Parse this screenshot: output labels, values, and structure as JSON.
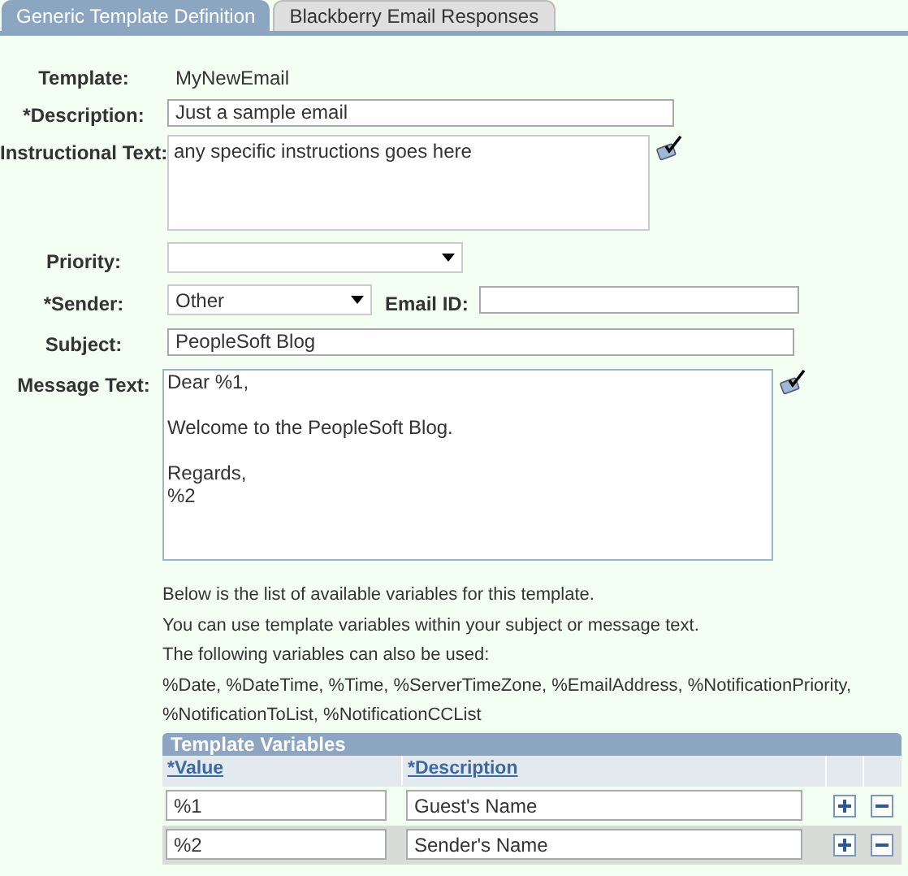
{
  "tabs": [
    {
      "label": "Generic Template Definition",
      "selected": true
    },
    {
      "label": "Blackberry Email Responses",
      "selected": false
    }
  ],
  "template": {
    "label": "Template:",
    "value": "MyNewEmail"
  },
  "description": {
    "label": "*Description:",
    "value": "Just a sample email"
  },
  "instructional_text": {
    "label": "Instructional Text:",
    "value": "any specific instructions goes here"
  },
  "priority": {
    "label": "Priority:"
  },
  "sender": {
    "label": "*Sender:",
    "value": "Other"
  },
  "email_id": {
    "label": "Email ID:"
  },
  "subject": {
    "label": "Subject:",
    "value": "PeopleSoft Blog"
  },
  "message_text": {
    "label": "Message Text:",
    "value": "Dear %1,\n\nWelcome to the PeopleSoft Blog.\n\nRegards,\n%2"
  },
  "help_lines": [
    "Below is the list of available variables for this template.",
    "You can use template variables within your subject or message text.",
    "The following variables can also be used:",
    "%Date, %DateTime, %Time, %ServerTimeZone, %EmailAddress, %NotificationPriority,",
    "%NotificationToList, %NotificationCCList"
  ],
  "template_variables": {
    "title": "Template Variables",
    "columns": [
      "*Value",
      "*Description"
    ],
    "rows": [
      {
        "value": "%1",
        "description": "Guest's Name"
      },
      {
        "value": "%2",
        "description": "Sender's Name"
      }
    ]
  }
}
